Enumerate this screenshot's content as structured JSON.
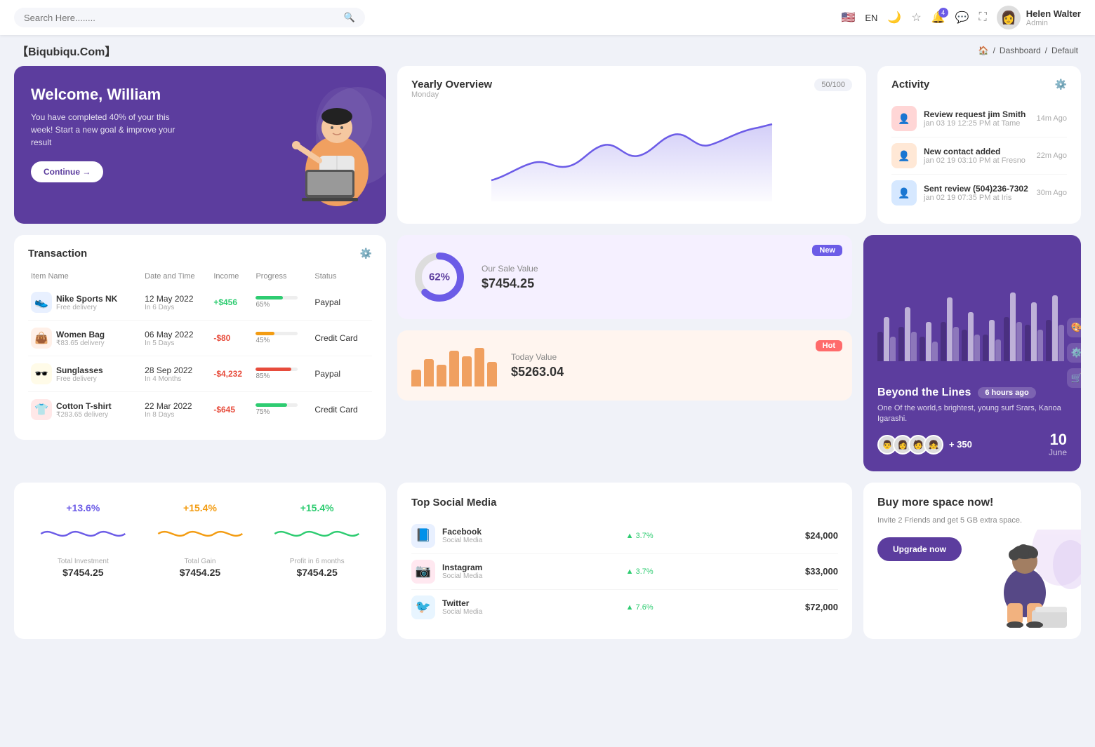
{
  "topnav": {
    "search_placeholder": "Search Here........",
    "lang": "EN",
    "notif_count": "4",
    "user_name": "Helen Walter",
    "user_role": "Admin"
  },
  "breadcrumb": {
    "brand": "【Biqubiqu.Com】",
    "home": "🏠",
    "dashboard": "Dashboard",
    "current": "Default"
  },
  "welcome": {
    "title": "Welcome, William",
    "subtitle": "You have completed 40% of your this week! Start a new goal & improve your result",
    "button": "Continue →"
  },
  "overview": {
    "title": "Yearly Overview",
    "subtitle": "Monday",
    "badge": "50/100"
  },
  "activity": {
    "title": "Activity",
    "items": [
      {
        "name": "Review request jim Smith",
        "sub": "jan 03 19 12:25 PM at Tame",
        "time": "14m Ago",
        "color": "#ffd6d6"
      },
      {
        "name": "New contact added",
        "sub": "jan 02 19 03:10 PM at Fresno",
        "time": "22m Ago",
        "color": "#ffe8d6"
      },
      {
        "name": "Sent review (504)236-7302",
        "sub": "jan 02 19 07:35 PM at Iris",
        "time": "30m Ago",
        "color": "#d6e8ff"
      }
    ]
  },
  "transaction": {
    "title": "Transaction",
    "headers": [
      "Item Name",
      "Date and Time",
      "Income",
      "Progress",
      "Status"
    ],
    "rows": [
      {
        "icon": "👟",
        "icon_bg": "#e8f0ff",
        "name": "Nike Sports NK",
        "sub": "Free delivery",
        "date": "12 May 2022",
        "date_sub": "In 6 Days",
        "income": "+$456",
        "income_type": "pos",
        "progress": 65,
        "progress_color": "#2ecc71",
        "status": "Paypal"
      },
      {
        "icon": "👜",
        "icon_bg": "#fff0e8",
        "name": "Women Bag",
        "sub": "₹83.65 delivery",
        "date": "06 May 2022",
        "date_sub": "In 5 Days",
        "income": "-$80",
        "income_type": "neg",
        "progress": 45,
        "progress_color": "#f39c12",
        "status": "Credit Card"
      },
      {
        "icon": "🕶️",
        "icon_bg": "#fffbe8",
        "name": "Sunglasses",
        "sub": "Free delivery",
        "date": "28 Sep 2022",
        "date_sub": "In 4 Months",
        "income": "-$4,232",
        "income_type": "neg",
        "progress": 85,
        "progress_color": "#e74c3c",
        "status": "Paypal"
      },
      {
        "icon": "👕",
        "icon_bg": "#ffe8e8",
        "name": "Cotton T-shirt",
        "sub": "₹283.65 delivery",
        "date": "22 Mar 2022",
        "date_sub": "In 8 Days",
        "income": "-$645",
        "income_type": "neg",
        "progress": 75,
        "progress_color": "#2ecc71",
        "status": "Credit Card"
      }
    ]
  },
  "sale_value": {
    "donut_percent": "62%",
    "donut_value": 62,
    "label": "Our Sale Value",
    "amount": "$7454.25",
    "tag": "New"
  },
  "today_value": {
    "label": "Today Value",
    "amount": "$5263.04",
    "tag": "Hot",
    "bars": [
      30,
      50,
      40,
      65,
      55,
      70,
      45
    ]
  },
  "beyond": {
    "title": "Beyond the Lines",
    "when": "6 hours ago",
    "desc": "One Of the world,s brightest, young surf Srars, Kanoa Igarashi.",
    "plus_count": "+ 350",
    "date_num": "10",
    "date_month": "June",
    "bars": [
      {
        "h1": 60,
        "h2": 90,
        "h3": 50
      },
      {
        "h1": 70,
        "h2": 110,
        "h3": 60
      },
      {
        "h1": 50,
        "h2": 80,
        "h3": 40
      },
      {
        "h1": 80,
        "h2": 130,
        "h3": 70
      },
      {
        "h1": 65,
        "h2": 100,
        "h3": 55
      },
      {
        "h1": 55,
        "h2": 85,
        "h3": 45
      },
      {
        "h1": 90,
        "h2": 140,
        "h3": 80
      },
      {
        "h1": 75,
        "h2": 120,
        "h3": 65
      },
      {
        "h1": 85,
        "h2": 135,
        "h3": 75
      }
    ]
  },
  "stats": [
    {
      "percent": "+13.6%",
      "label": "Total Investment",
      "value": "$7454.25",
      "color": "#6c5ce7"
    },
    {
      "percent": "+15.4%",
      "label": "Total Gain",
      "value": "$7454.25",
      "color": "#f39c12"
    },
    {
      "percent": "+15.4%",
      "label": "Profit in 6 months",
      "value": "$7454.25",
      "color": "#2ecc71"
    }
  ],
  "social": {
    "title": "Top Social Media",
    "items": [
      {
        "name": "Facebook",
        "sub": "Social Media",
        "growth": "3.7%",
        "amount": "$24,000",
        "icon": "📘",
        "icon_bg": "#e8f0ff"
      },
      {
        "name": "Instagram",
        "sub": "Social Media",
        "growth": "3.7%",
        "amount": "$33,000",
        "icon": "📷",
        "icon_bg": "#ffe8f0"
      },
      {
        "name": "Twitter",
        "sub": "Social Media",
        "growth": "7.6%",
        "amount": "$72,000",
        "icon": "🐦",
        "icon_bg": "#e8f5ff"
      }
    ]
  },
  "buy_space": {
    "title": "Buy more space now!",
    "desc": "Invite 2 Friends and get 5 GB extra space.",
    "button": "Upgrade now"
  }
}
